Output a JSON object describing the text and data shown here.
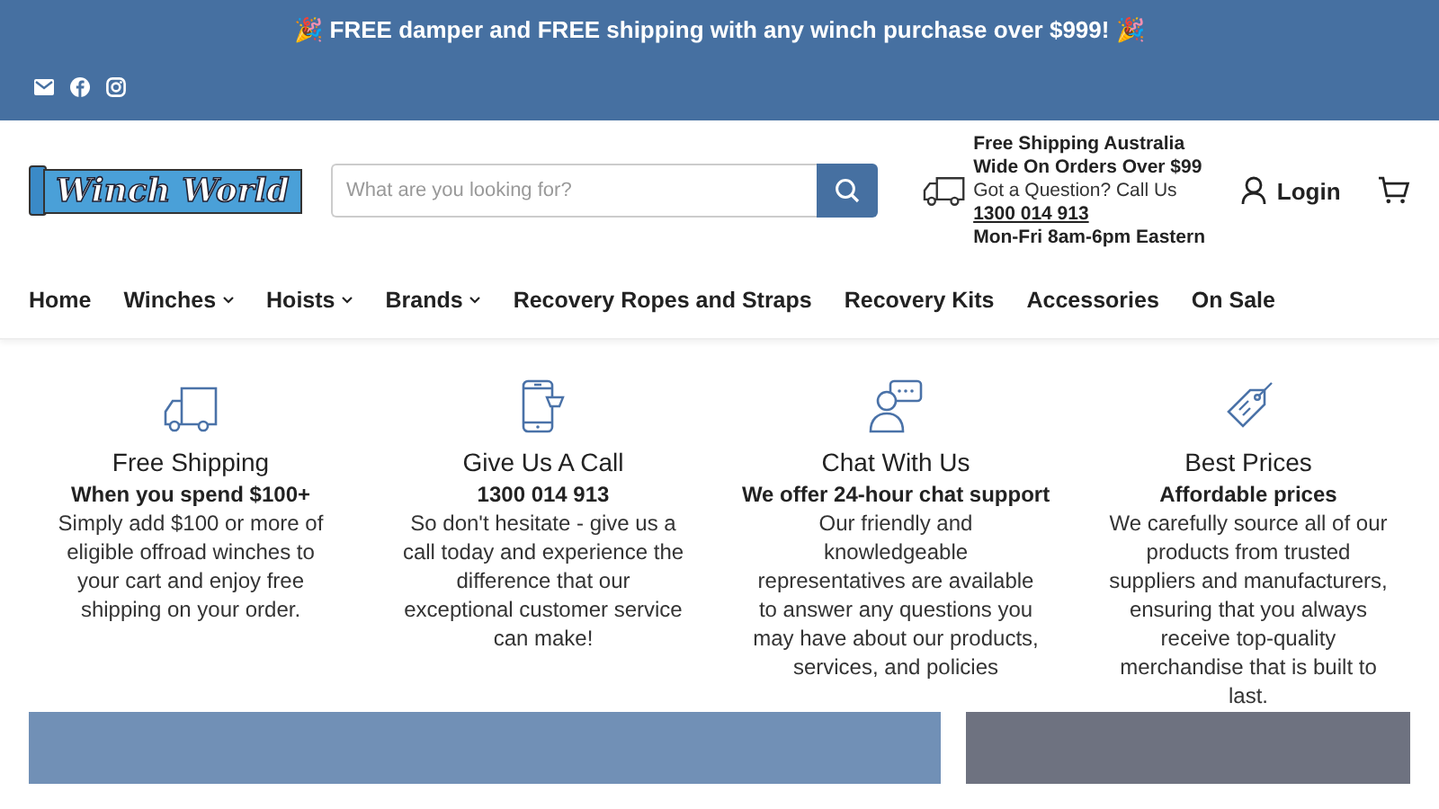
{
  "announcement": "🎉 FREE damper and FREE shipping with any winch purchase over $999! 🎉",
  "logo": "Winch World",
  "search": {
    "placeholder": "What are you looking for?"
  },
  "shipping_info": {
    "headline": "Free Shipping Australia Wide On Orders Over $99",
    "question": "Got a Question? Call Us",
    "phone": "1300 014 913",
    "hours": "Mon-Fri 8am-6pm Eastern"
  },
  "login": "Login",
  "nav": [
    {
      "label": "Home",
      "dropdown": false
    },
    {
      "label": "Winches",
      "dropdown": true
    },
    {
      "label": "Hoists",
      "dropdown": true
    },
    {
      "label": "Brands",
      "dropdown": true
    },
    {
      "label": "Recovery Ropes and Straps",
      "dropdown": false
    },
    {
      "label": "Recovery Kits",
      "dropdown": false
    },
    {
      "label": "Accessories",
      "dropdown": false
    },
    {
      "label": "On Sale",
      "dropdown": false
    }
  ],
  "features": [
    {
      "kind": "truck",
      "title": "Free Shipping",
      "subtitle": "When you spend $100+",
      "text": "Simply add $100 or more of eligible offroad winches to your cart and enjoy free shipping on your order."
    },
    {
      "kind": "phone",
      "title": "Give Us A Call",
      "subtitle": "1300 014 913",
      "text": "So don't hesitate - give us a call today and experience the difference that our exceptional customer service can make!"
    },
    {
      "kind": "chat",
      "title": "Chat With Us",
      "subtitle": "We offer 24-hour chat support",
      "text": "Our friendly and knowledgeable representatives are available to answer any questions you may have about our products, services, and policies"
    },
    {
      "kind": "tag",
      "title": "Best Prices",
      "subtitle": "Affordable prices",
      "text": "We carefully source all of our products from trusted suppliers and manufacturers, ensuring that you always receive top-quality merchandise that is built to last."
    }
  ]
}
